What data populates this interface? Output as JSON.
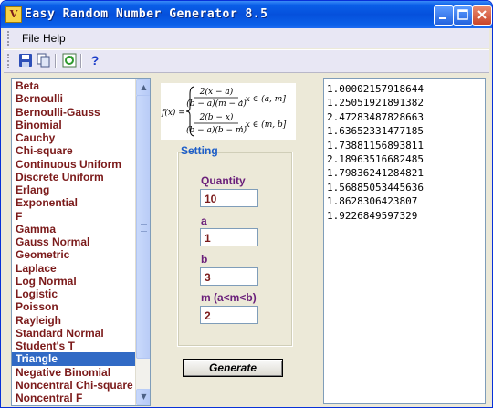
{
  "window": {
    "title": "Easy Random Number Generator 8.5",
    "app_icon_glyph": "V"
  },
  "menu": {
    "file": "File",
    "help": "Help"
  },
  "toolbar": {
    "help_glyph": "?"
  },
  "distributions": {
    "items": [
      "Beta",
      "Bernoulli",
      "Bernoulli-Gauss",
      "Binomial",
      "Cauchy",
      "Chi-square",
      "Continuous Uniform",
      "Discrete Uniform",
      "Erlang",
      "Exponential",
      "F",
      "Gamma",
      "Gauss Normal",
      "Geometric",
      "Laplace",
      "Log Normal",
      "Logistic",
      "Poisson",
      "Rayleigh",
      "Standard Normal",
      "Student's T",
      "Triangle",
      "Negative Binomial",
      "Noncentral Chi-square",
      "Noncentral F"
    ],
    "selected": "Triangle"
  },
  "formula": {
    "lhs": "f(x) =",
    "num1": "2(x − a)",
    "den1": "(b − a)(m − a)",
    "cond1": ", x ∈ (a, m]",
    "num2": "2(b − x)",
    "den2": "(b − a)(b − m)",
    "cond2": ", x ∈ (m, b]"
  },
  "setting": {
    "title": "Setting",
    "quantity_label": "Quantity",
    "quantity_value": "10",
    "a_label": "a",
    "a_value": "1",
    "b_label": "b",
    "b_value": "3",
    "m_label": "m (a<m<b)",
    "m_value": "2"
  },
  "generate_label": "Generate",
  "results": [
    "1.00002157918644",
    "1.25051921891382",
    "2.47283487828663",
    "1.63652331477185",
    "1.73881156893811",
    "2.18963516682485",
    "1.79836241284821",
    "1.56885053445636",
    "1.8628306423807",
    "1.9226849597329"
  ],
  "colors": {
    "title_bar": "#0550dc",
    "selection": "#316ac5",
    "list_text": "#7b1a1a",
    "setting_title": "#1d5ec9",
    "field_label": "#6a1f7a"
  }
}
